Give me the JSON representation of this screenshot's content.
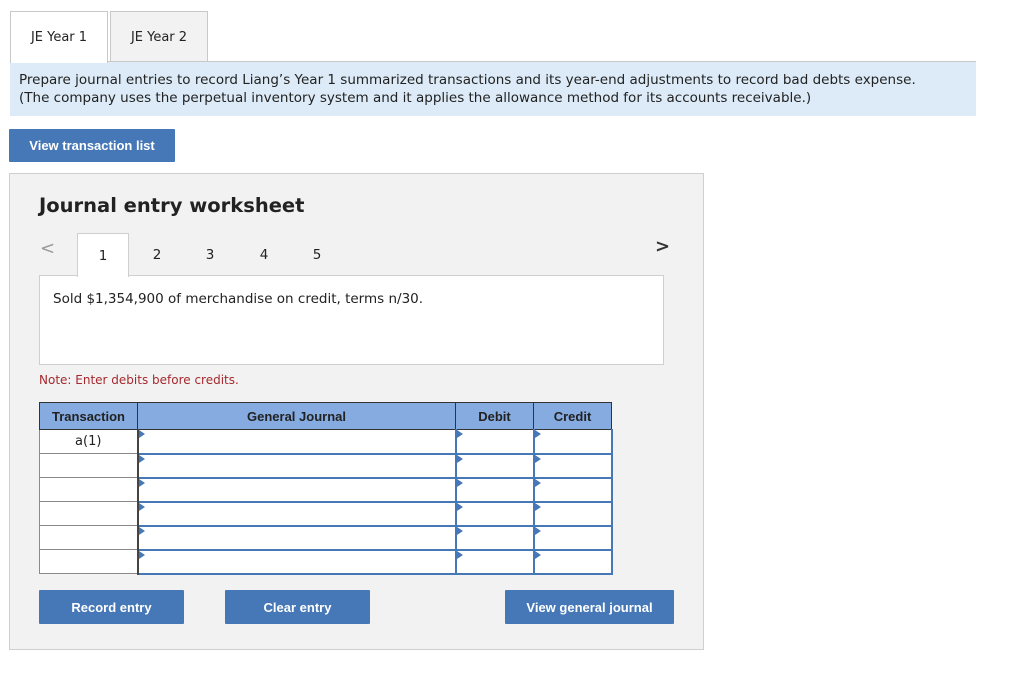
{
  "tabs": [
    {
      "label": "JE Year 1",
      "active": true
    },
    {
      "label": "JE Year 2",
      "active": false
    }
  ],
  "instructions": {
    "line1": "Prepare journal entries to record Liang’s Year 1 summarized transactions and its year-end adjustments to record bad debts expense.",
    "line2": "(The company uses the perpetual inventory system and it applies the allowance method for its accounts receivable.)"
  },
  "view_transaction_list_label": "View transaction list",
  "worksheet": {
    "title": "Journal entry worksheet",
    "prev_icon": "<",
    "next_icon": ">",
    "steps": [
      "1",
      "2",
      "3",
      "4",
      "5"
    ],
    "active_step": "1",
    "description": "Sold $1,354,900 of merchandise on credit, terms n/30.",
    "note": "Note: Enter debits before credits.",
    "table": {
      "headers": {
        "transaction": "Transaction",
        "general_journal": "General Journal",
        "debit": "Debit",
        "credit": "Credit"
      },
      "rows": [
        {
          "transaction": "a(1)"
        },
        {
          "transaction": ""
        },
        {
          "transaction": ""
        },
        {
          "transaction": ""
        },
        {
          "transaction": ""
        },
        {
          "transaction": ""
        }
      ]
    },
    "buttons": {
      "record": "Record entry",
      "clear": "Clear entry",
      "view_general_journal": "View general journal"
    }
  },
  "colors": {
    "accent": "#4678b8",
    "header_bg": "#85abe0",
    "instructions_bg": "#dcebf7",
    "note_color": "#a5292e"
  }
}
